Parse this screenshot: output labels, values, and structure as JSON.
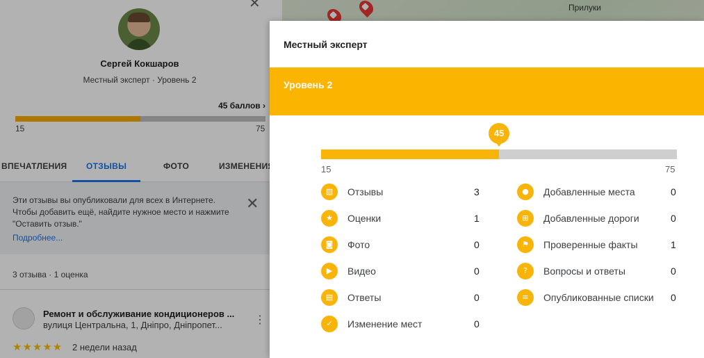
{
  "map": {
    "city_label": "Прилуки"
  },
  "profile": {
    "name": "Сергей Кокшаров",
    "subtitle": "Местный эксперт · Уровень 2",
    "points": "45 баллов",
    "progress_fraction": 0.5,
    "range_min": "15",
    "range_max": "75"
  },
  "tabs": [
    {
      "label": "ВПЕЧАТЛЕНИЯ"
    },
    {
      "label": "ОТЗЫВЫ"
    },
    {
      "label": "ФОТО"
    },
    {
      "label": "ИЗМЕНЕНИЯ"
    }
  ],
  "notice": {
    "text": "Эти отзывы вы опубликовали для всех в Интернете. Чтобы добавить ещё, найдите нужное место и нажмите \"Оставить отзыв.\"",
    "link": "Подробнее..."
  },
  "counts": "3 отзыва · 1 оценка",
  "review": {
    "title": "Ремонт и обслуживание кондиционеров ...",
    "address": "вулиця Центральна, 1, Дніпро, Дніпропет...",
    "stars": "★★★★★",
    "date": "2 недели назад"
  },
  "dialog": {
    "title": "Местный эксперт",
    "level": "Уровень 2",
    "points_value": "45",
    "progress_fraction": 0.5,
    "range_min": "15",
    "range_max": "75",
    "stats_left": [
      {
        "icon": "review-icon",
        "label": "Отзывы",
        "value": "3"
      },
      {
        "icon": "star-icon",
        "label": "Оценки",
        "value": "1"
      },
      {
        "icon": "camera-icon",
        "label": "Фото",
        "value": "0"
      },
      {
        "icon": "video-icon",
        "label": "Видео",
        "value": "0"
      },
      {
        "icon": "answer-icon",
        "label": "Ответы",
        "value": "0"
      },
      {
        "icon": "edit-place-icon",
        "label": "Изменение мест",
        "value": "0"
      }
    ],
    "stats_right": [
      {
        "icon": "place-pin-icon",
        "label": "Добавленные места",
        "value": "0"
      },
      {
        "icon": "road-icon",
        "label": "Добавленные дороги",
        "value": "0"
      },
      {
        "icon": "flag-icon",
        "label": "Проверенные факты",
        "value": "1"
      },
      {
        "icon": "qa-icon",
        "label": "Вопросы и ответы",
        "value": "0"
      },
      {
        "icon": "list-icon",
        "label": "Опубликованные списки",
        "value": "0"
      }
    ]
  },
  "colors": {
    "accent": "#f9b40a",
    "link": "#1a73e8",
    "star": "#fbbc04"
  }
}
